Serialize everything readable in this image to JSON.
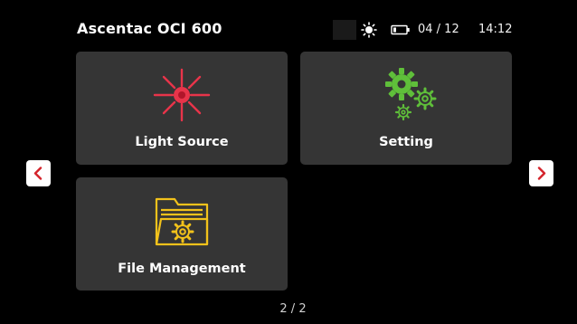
{
  "header": {
    "title": "Ascentac OCI 600"
  },
  "status": {
    "date": "04 / 12",
    "time": "14:12",
    "icons": [
      "brightness-icon",
      "battery-icon"
    ]
  },
  "tiles": [
    {
      "label": "Light Source",
      "icon": "laser-starburst-icon",
      "icon_color": "#e8344a"
    },
    {
      "label": "Setting",
      "icon": "gears-icon",
      "icon_color": "#5fbf3a"
    },
    {
      "label": "File Management",
      "icon": "folder-gear-icon",
      "icon_color": "#f2c21b"
    }
  ],
  "navigation": {
    "prev_icon": "chevron-left-icon",
    "next_icon": "chevron-right-icon",
    "arrow_color": "#d4232b"
  },
  "pager": {
    "text": "2 / 2"
  },
  "colors": {
    "background": "#000000",
    "tile": "#353535"
  }
}
